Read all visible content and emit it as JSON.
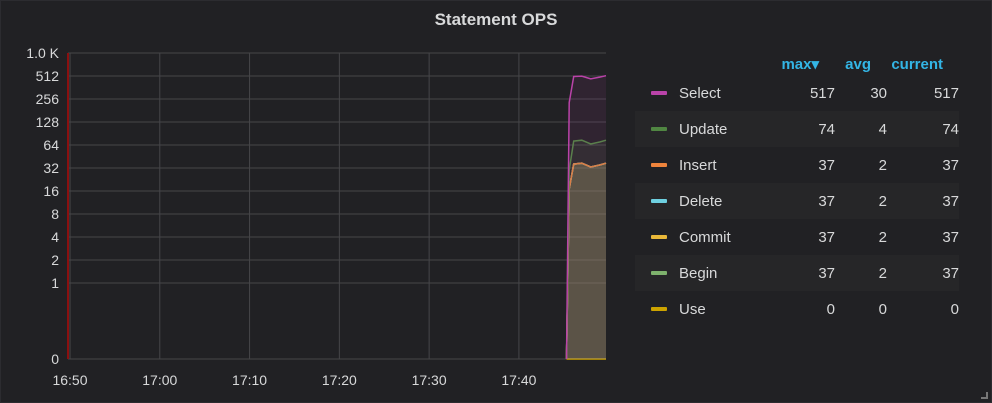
{
  "panel": {
    "title": "Statement OPS"
  },
  "legend": {
    "headers": {
      "max": "max",
      "max_sort_icon": "▾",
      "avg": "avg",
      "current": "current"
    },
    "items": [
      {
        "name": "Select",
        "color": "#ba43a9",
        "max": "517",
        "avg": "30",
        "current": "517"
      },
      {
        "name": "Update",
        "color": "#508642",
        "max": "74",
        "avg": "4",
        "current": "74"
      },
      {
        "name": "Insert",
        "color": "#ef843c",
        "max": "37",
        "avg": "2",
        "current": "37"
      },
      {
        "name": "Delete",
        "color": "#6ed0e0",
        "max": "37",
        "avg": "2",
        "current": "37"
      },
      {
        "name": "Commit",
        "color": "#eab839",
        "max": "37",
        "avg": "2",
        "current": "37"
      },
      {
        "name": "Begin",
        "color": "#7eb26d",
        "max": "37",
        "avg": "2",
        "current": "37"
      },
      {
        "name": "Use",
        "color": "#cca300",
        "max": "0",
        "avg": "0",
        "current": "0"
      }
    ]
  },
  "chart_data": {
    "type": "line",
    "title": "Statement OPS",
    "yscale": "log2",
    "y_ticks": [
      "0",
      "1",
      "2",
      "4",
      "8",
      "16",
      "32",
      "64",
      "128",
      "256",
      "512",
      "1.0 K"
    ],
    "y_tick_values": [
      0,
      1,
      2,
      4,
      8,
      16,
      32,
      64,
      128,
      256,
      512,
      1024
    ],
    "x_ticks": [
      "16:50",
      "17:00",
      "17:10",
      "17:20",
      "17:30",
      "17:40"
    ],
    "x_unit": "minutes since 16:50",
    "xlim": [
      0,
      59.7
    ],
    "x": [
      55.3,
      55.6,
      56.1,
      57.0,
      58.0,
      59.0,
      59.7
    ],
    "series": [
      {
        "name": "Select",
        "values": [
          0,
          230,
          505,
          510,
          470,
          495,
          517
        ]
      },
      {
        "name": "Update",
        "values": [
          0,
          30,
          72,
          74,
          66,
          70,
          74
        ]
      },
      {
        "name": "Insert",
        "values": [
          0,
          17,
          36,
          37,
          33,
          35,
          37
        ]
      },
      {
        "name": "Delete",
        "values": [
          0,
          17,
          36,
          37,
          33,
          35,
          37
        ]
      },
      {
        "name": "Commit",
        "values": [
          0,
          17,
          36,
          37,
          33,
          35,
          37
        ]
      },
      {
        "name": "Begin",
        "values": [
          0,
          17,
          36,
          37,
          33,
          35,
          37
        ]
      },
      {
        "name": "Use",
        "values": [
          0,
          0,
          0,
          0,
          0,
          0,
          0
        ]
      }
    ]
  }
}
